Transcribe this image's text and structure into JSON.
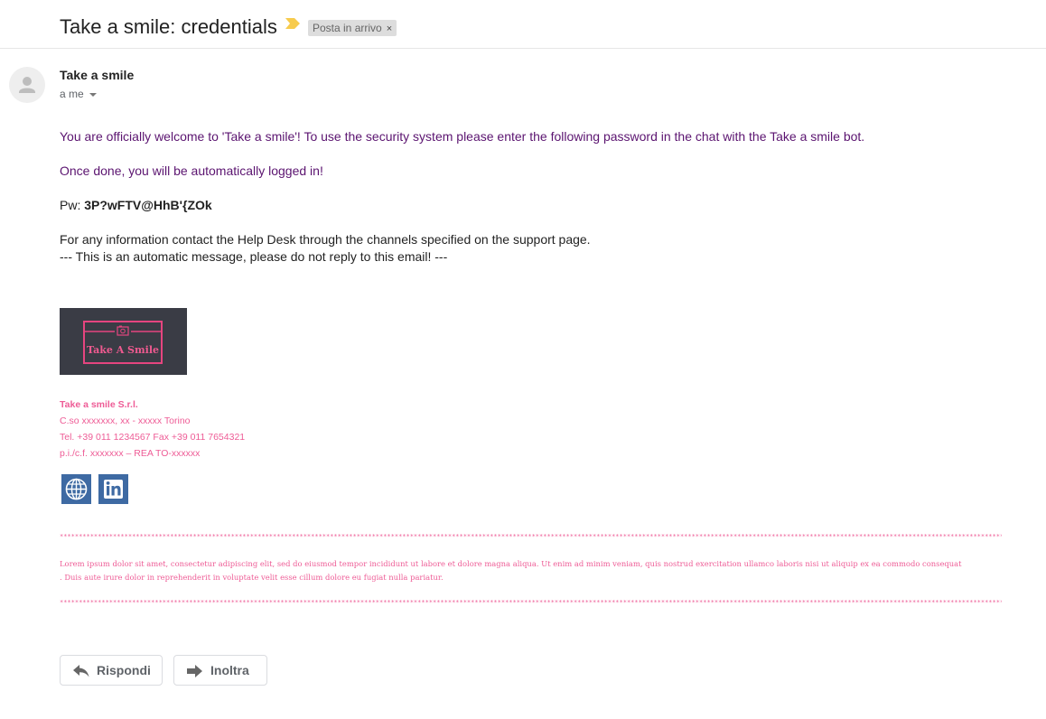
{
  "email": {
    "subject": "Take a smile: credentials",
    "label_chip": "Posta in arrivo",
    "label_remove": "×",
    "sender_name": "Take a smile",
    "recipient": "a me"
  },
  "body": {
    "line1": "You are officially welcome to 'Take a smile'! To use the security system please enter the following password in the chat with the Take a smile bot.",
    "line2": "Once done, you will be automatically logged in!",
    "pw_label": "Pw: ",
    "pw_value": "3P?wFTV@HhB'{ZOk",
    "line3": "For any information contact the Help Desk through the channels specified on the support page.",
    "line4": "--- This is an automatic message, please do not reply to this email! ---"
  },
  "signature": {
    "logo_text": "Take A Smile",
    "company": "Take a smile S.r.l.",
    "address": "C.so xxxxxxx, xx - xxxxx Torino",
    "phone": "Tel. +39 011 1234567 Fax +39 011 7654321",
    "tax": "p.i./c.f. xxxxxxx – REA TO-xxxxxx",
    "social_icons": [
      "globe-icon",
      "linkedin-icon"
    ]
  },
  "footer": {
    "separator": "************************************************************************************************************************************************************************************************************************************************************************************************************************************************************************************************",
    "lorem1": "Lorem ipsum dolor sit amet, consectetur adipiscing elit, sed do eiusmod tempor incididunt ut labore et dolore magna aliqua. Ut enim ad minim veniam, quis nostrud exercitation ullamco laboris nisi ut aliquip ex ea commodo consequat",
    "lorem2": ". Duis aute irure dolor in reprehenderit in voluptate velit esse cillum dolore eu fugiat nulla pariatur."
  },
  "actions": {
    "reply": "Rispondi",
    "forward": "Inoltra"
  },
  "colors": {
    "accent_pink": "#ee5c96",
    "body_purple": "#5b1470",
    "social_blue": "#3e6aa3"
  }
}
